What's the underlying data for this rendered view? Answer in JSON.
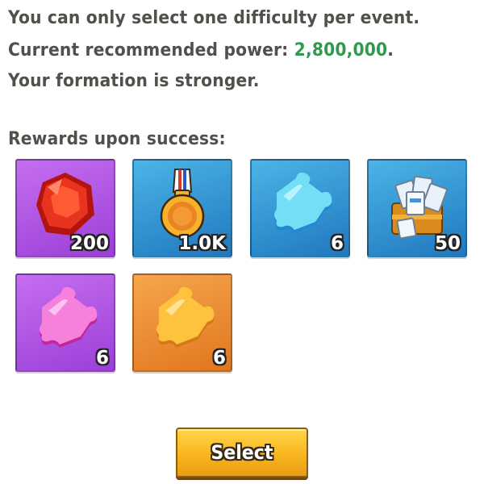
{
  "info": {
    "line1": "You can only select one difficulty per event.",
    "line2_prefix": "Current recommended power: ",
    "line2_value": "2,800,000",
    "line2_suffix": ".",
    "line3": "Your formation is stronger."
  },
  "rewards": {
    "title": "Rewards upon success:",
    "items": [
      {
        "icon": "red-gem-icon",
        "quantity": "200",
        "bg": "#b259e6"
      },
      {
        "icon": "gold-medal-icon",
        "quantity": "1.0K",
        "bg": "#2f94d4"
      },
      {
        "icon": "blue-puzzle-piece-icon",
        "quantity": "6",
        "bg": "#2f94d4"
      },
      {
        "icon": "exp-books-chest-icon",
        "quantity": "50",
        "bg": "#2f94d4"
      },
      {
        "icon": "pink-puzzle-piece-icon",
        "quantity": "6",
        "bg": "#b259e6"
      },
      {
        "icon": "orange-puzzle-piece-icon",
        "quantity": "6",
        "bg": "#ec8d33"
      }
    ]
  },
  "actions": {
    "select_label": "Select"
  },
  "colors": {
    "text": "#53504c",
    "power_value": "#2f9a4d",
    "button": "#f8b61e"
  }
}
